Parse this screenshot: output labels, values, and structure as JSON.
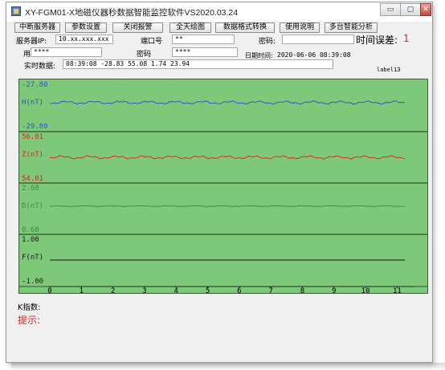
{
  "window": {
    "title": "XY-FGM01-X地磁仪器秒数据智能监控软件VS2020.03.24",
    "min_glyph": "▭",
    "max_glyph": "▢",
    "close_glyph": "✕"
  },
  "toolbar": {
    "buttons": [
      "中断服务器",
      "参数设置",
      "关闭报警",
      "全天绘图",
      "数据格式转换",
      "使用说明",
      "多台智能分析"
    ]
  },
  "form": {
    "server_ip_label": "服务器IP:",
    "server_ip_value": "10.xx.xxx.xxx",
    "port_label": "端口号",
    "port_value": "**",
    "password_label": "密码:",
    "password_value": "",
    "time_error_label": "时间误差:",
    "time_error_value": "1",
    "user_label": "用户",
    "user_value": "****",
    "user_password_label": "密码",
    "user_password_value": "****",
    "datetime_label": "日期时间:",
    "datetime_value": "2020-06-06 08:39:08",
    "realtime_label": "实时数据:",
    "realtime_value": "08:39:08 -28.83 55.08 1.74 23.94",
    "label13": "label13"
  },
  "chart_data": {
    "type": "line",
    "background": "#7ec87a",
    "x_ticks": [
      "0",
      "1",
      "2",
      "3",
      "4",
      "5",
      "6",
      "7",
      "8",
      "9",
      "10",
      "11"
    ],
    "xlim": [
      0,
      11.6
    ],
    "panels": [
      {
        "name": "H(nT)",
        "color": "#2d52c8",
        "ylim_label_top": "-27.80",
        "ylim_label_bottom": "-29.80",
        "level": 0.52
      },
      {
        "name": "Z(nT)",
        "color": "#e0231c",
        "ylim_label_top": "56.01",
        "ylim_label_bottom": "54.01",
        "level": 0.5
      },
      {
        "name": "D(nT)",
        "color": "#3b8c3b",
        "ylim_label_top": "2.68",
        "ylim_label_bottom": "0.68",
        "level": 0.55
      },
      {
        "name": "F(nT)",
        "color": "#1a1a1a",
        "ylim_label_top": "1.00",
        "ylim_label_bottom": "-1.00",
        "level": 0.5
      }
    ]
  },
  "footer": {
    "k_index_label": "K指数:",
    "hint_label": "提示:"
  }
}
